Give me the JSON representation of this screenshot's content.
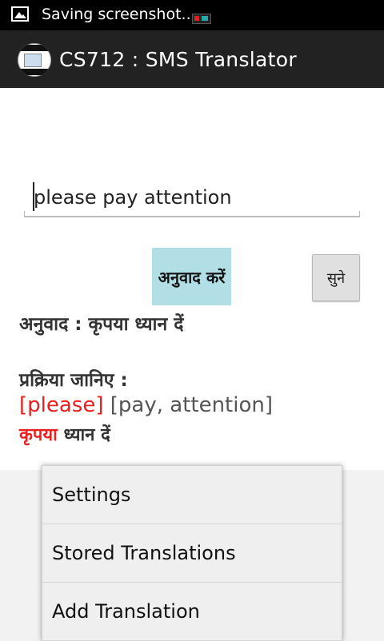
{
  "status_bar": {
    "text": "Saving screenshot...",
    "icons": [
      "image-icon",
      "notification-icon"
    ]
  },
  "action_bar": {
    "title": "CS712 : SMS Translator",
    "app_icon": "app-icon"
  },
  "main": {
    "input": {
      "value": "please pay attention",
      "placeholder": ""
    },
    "translate_button": "अनुवाद करें",
    "listen_button": "सुने",
    "result_text": "अनुवाद : कृपया ध्यान दें",
    "process_heading": "प्रक्रिया जानिए :",
    "tokens": {
      "highlighted": "[please]",
      "rest": " [pay, attention]"
    },
    "hindi_tokens": {
      "highlighted": "कृपया",
      "rest": " ध्यान दें"
    },
    "colors": {
      "highlight": "#e82020",
      "translate_button_bg": "#b2dfe6"
    }
  },
  "menu": {
    "items": [
      {
        "label": "Settings"
      },
      {
        "label": "Stored Translations"
      },
      {
        "label": "Add Translation"
      }
    ]
  }
}
